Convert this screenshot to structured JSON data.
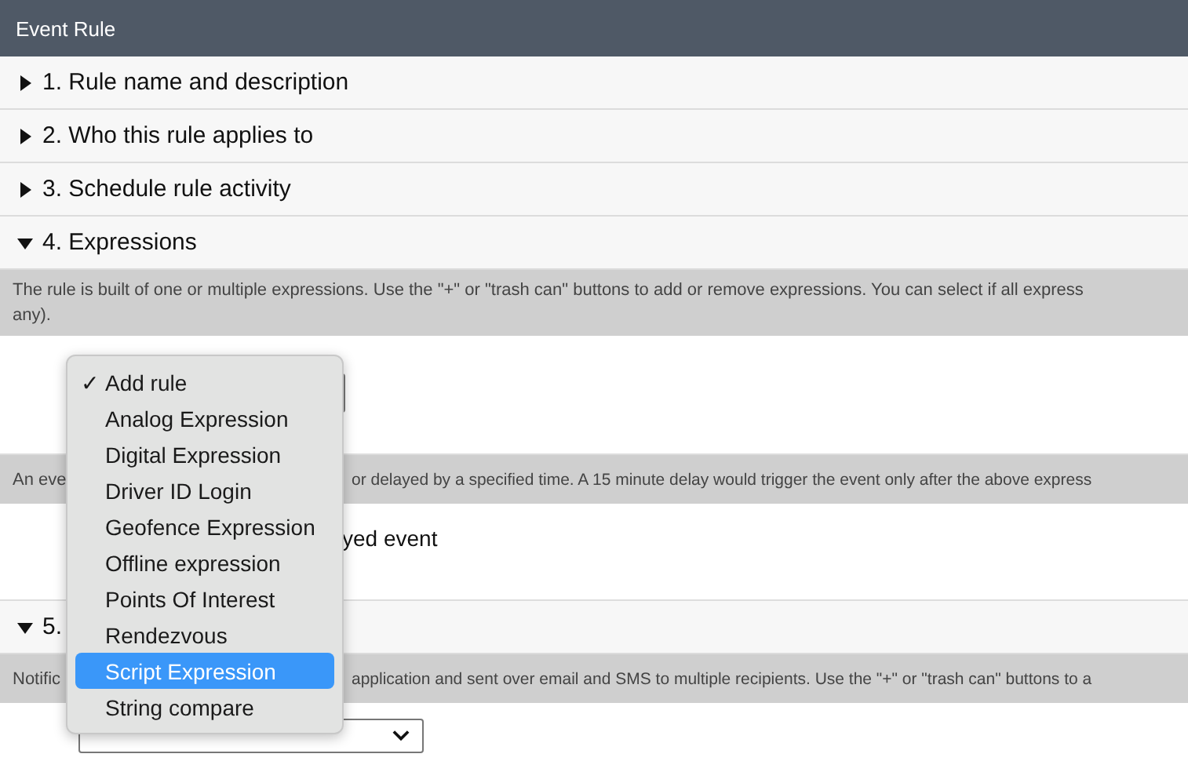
{
  "window": {
    "title": "Event Rule"
  },
  "sections": [
    {
      "title": "1. Rule name and description",
      "expanded": false
    },
    {
      "title": "2. Who this rule applies to",
      "expanded": false
    },
    {
      "title": "3. Schedule rule activity",
      "expanded": false
    },
    {
      "title": "4. Expressions",
      "expanded": true,
      "blocks": [
        {
          "description": [
            "The rule is built of one or multiple expressions. Use the \"+\" or \"trash can\" buttons to add or remove expressions. You can select if all express",
            "any)."
          ],
          "control": {
            "kind": "select"
          }
        },
        {
          "fragments": [
            "An eve",
            "or delayed by a specified time. A 15 minute delay would trigger the event only after the above express"
          ],
          "control": {
            "kind": "text",
            "text": "yed event"
          }
        }
      ]
    },
    {
      "title": "5.",
      "expanded": true,
      "blocks": [
        {
          "fragments": [
            "Notific",
            "application and sent over email and SMS to multiple recipients. Use the \"+\" or \"trash can\" buttons to a"
          ],
          "control": {
            "kind": "wide_select"
          }
        }
      ]
    }
  ],
  "dropdown": {
    "check_mark": "✓",
    "items": [
      {
        "label": "Add rule",
        "checked": true,
        "selected": false
      },
      {
        "label": "Analog Expression",
        "checked": false,
        "selected": false
      },
      {
        "label": "Digital Expression",
        "checked": false,
        "selected": false
      },
      {
        "label": "Driver ID Login",
        "checked": false,
        "selected": false
      },
      {
        "label": "Geofence Expression",
        "checked": false,
        "selected": false
      },
      {
        "label": "Offline expression",
        "checked": false,
        "selected": false
      },
      {
        "label": "Points Of Interest",
        "checked": false,
        "selected": false
      },
      {
        "label": "Rendezvous",
        "checked": false,
        "selected": false
      },
      {
        "label": "Script Expression",
        "checked": false,
        "selected": true
      },
      {
        "label": "String compare",
        "checked": false,
        "selected": false
      }
    ]
  }
}
